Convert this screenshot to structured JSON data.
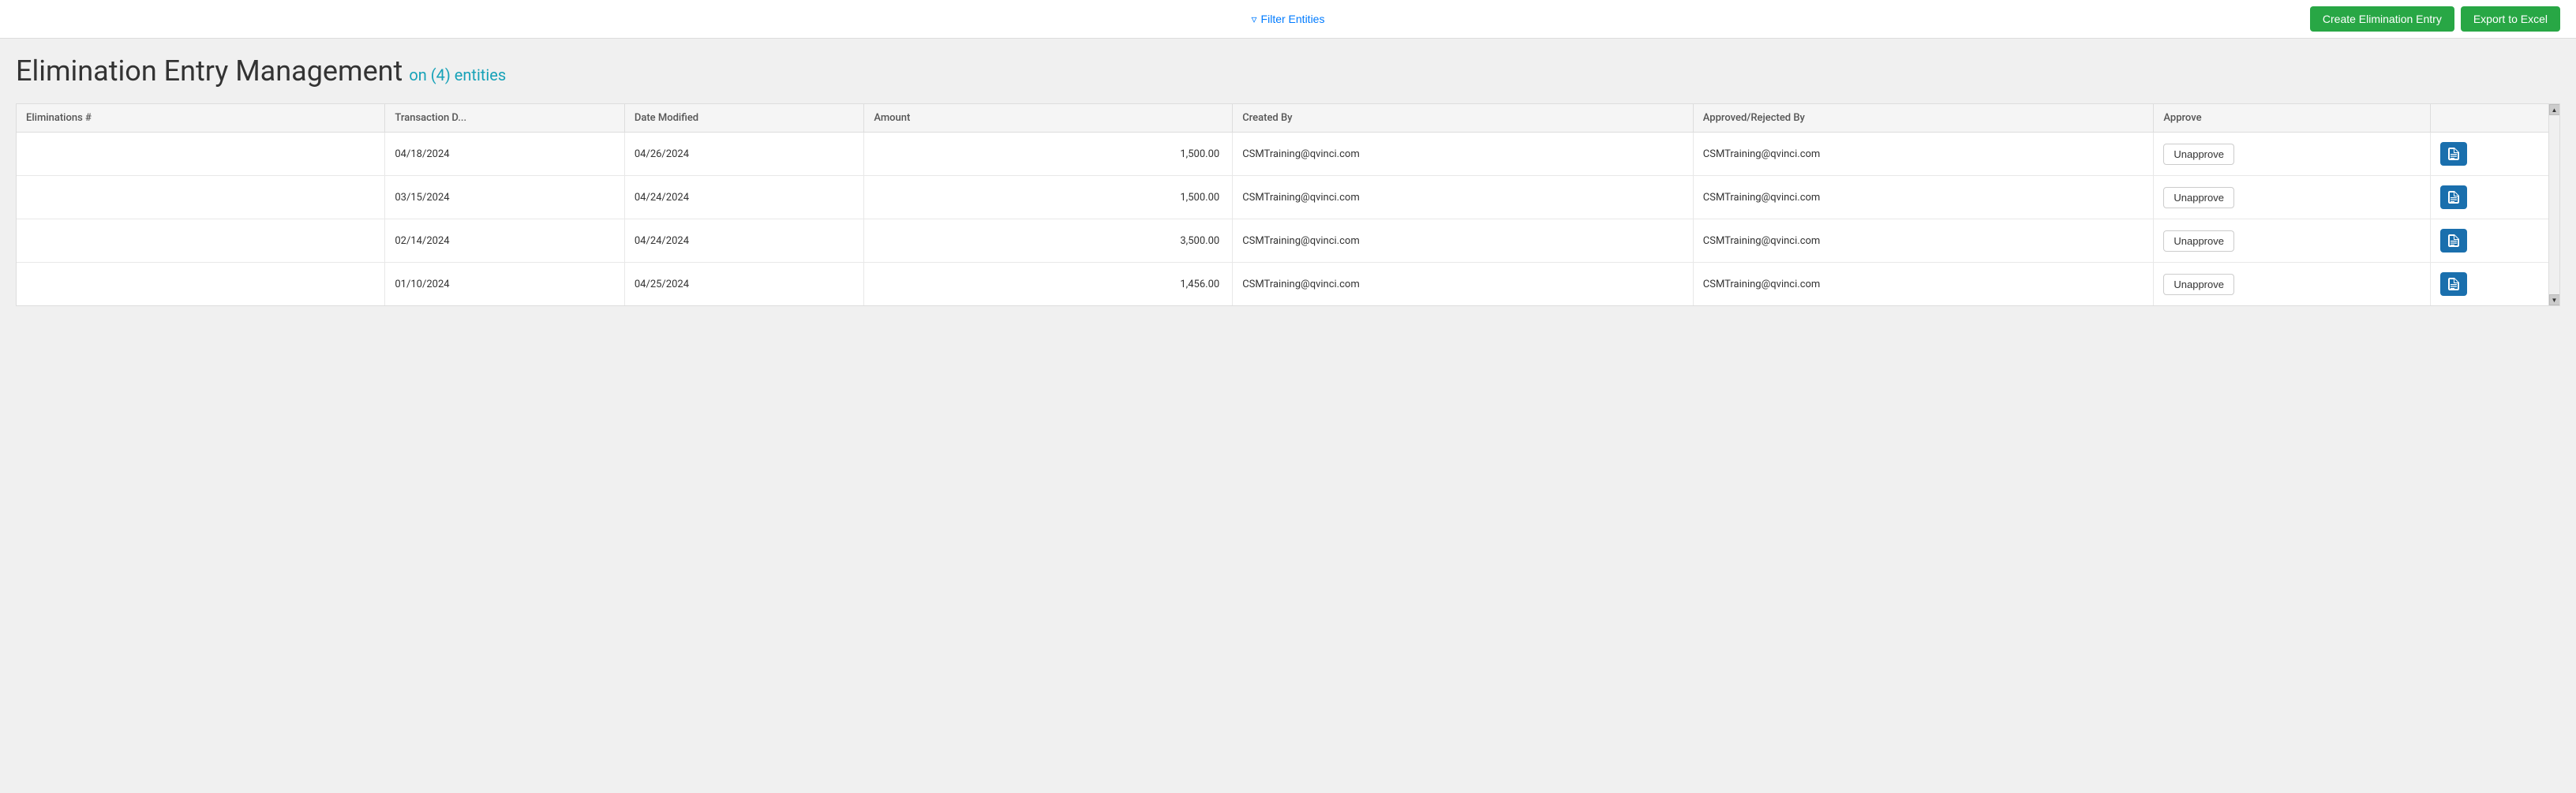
{
  "topbar": {
    "filter_label": "Filter Entities",
    "create_btn": "Create Elimination Entry",
    "export_btn": "Export to Excel"
  },
  "page": {
    "title": "Elimination Entry Management",
    "entity_count": "on (4) entities"
  },
  "table": {
    "columns": [
      "Eliminations #",
      "Transaction D...",
      "Date Modified",
      "Amount",
      "Created By",
      "Approved/Rejected By",
      "Approve",
      ""
    ],
    "rows": [
      {
        "elim_num": "",
        "transaction_date": "04/18/2024",
        "date_modified": "04/26/2024",
        "amount": "1,500.00",
        "created_by": "CSMTraining@qvinci.com",
        "approved_by": "CSMTraining@qvinci.com",
        "approve_label": "Unapprove"
      },
      {
        "elim_num": "",
        "transaction_date": "03/15/2024",
        "date_modified": "04/24/2024",
        "amount": "1,500.00",
        "created_by": "CSMTraining@qvinci.com",
        "approved_by": "CSMTraining@qvinci.com",
        "approve_label": "Unapprove"
      },
      {
        "elim_num": "",
        "transaction_date": "02/14/2024",
        "date_modified": "04/24/2024",
        "amount": "3,500.00",
        "created_by": "CSMTraining@qvinci.com",
        "approved_by": "CSMTraining@qvinci.com",
        "approve_label": "Unapprove"
      },
      {
        "elim_num": "",
        "transaction_date": "01/10/2024",
        "date_modified": "04/25/2024",
        "amount": "1,456.00",
        "created_by": "CSMTraining@qvinci.com",
        "approved_by": "CSMTraining@qvinci.com",
        "approve_label": "Unapprove"
      }
    ]
  }
}
